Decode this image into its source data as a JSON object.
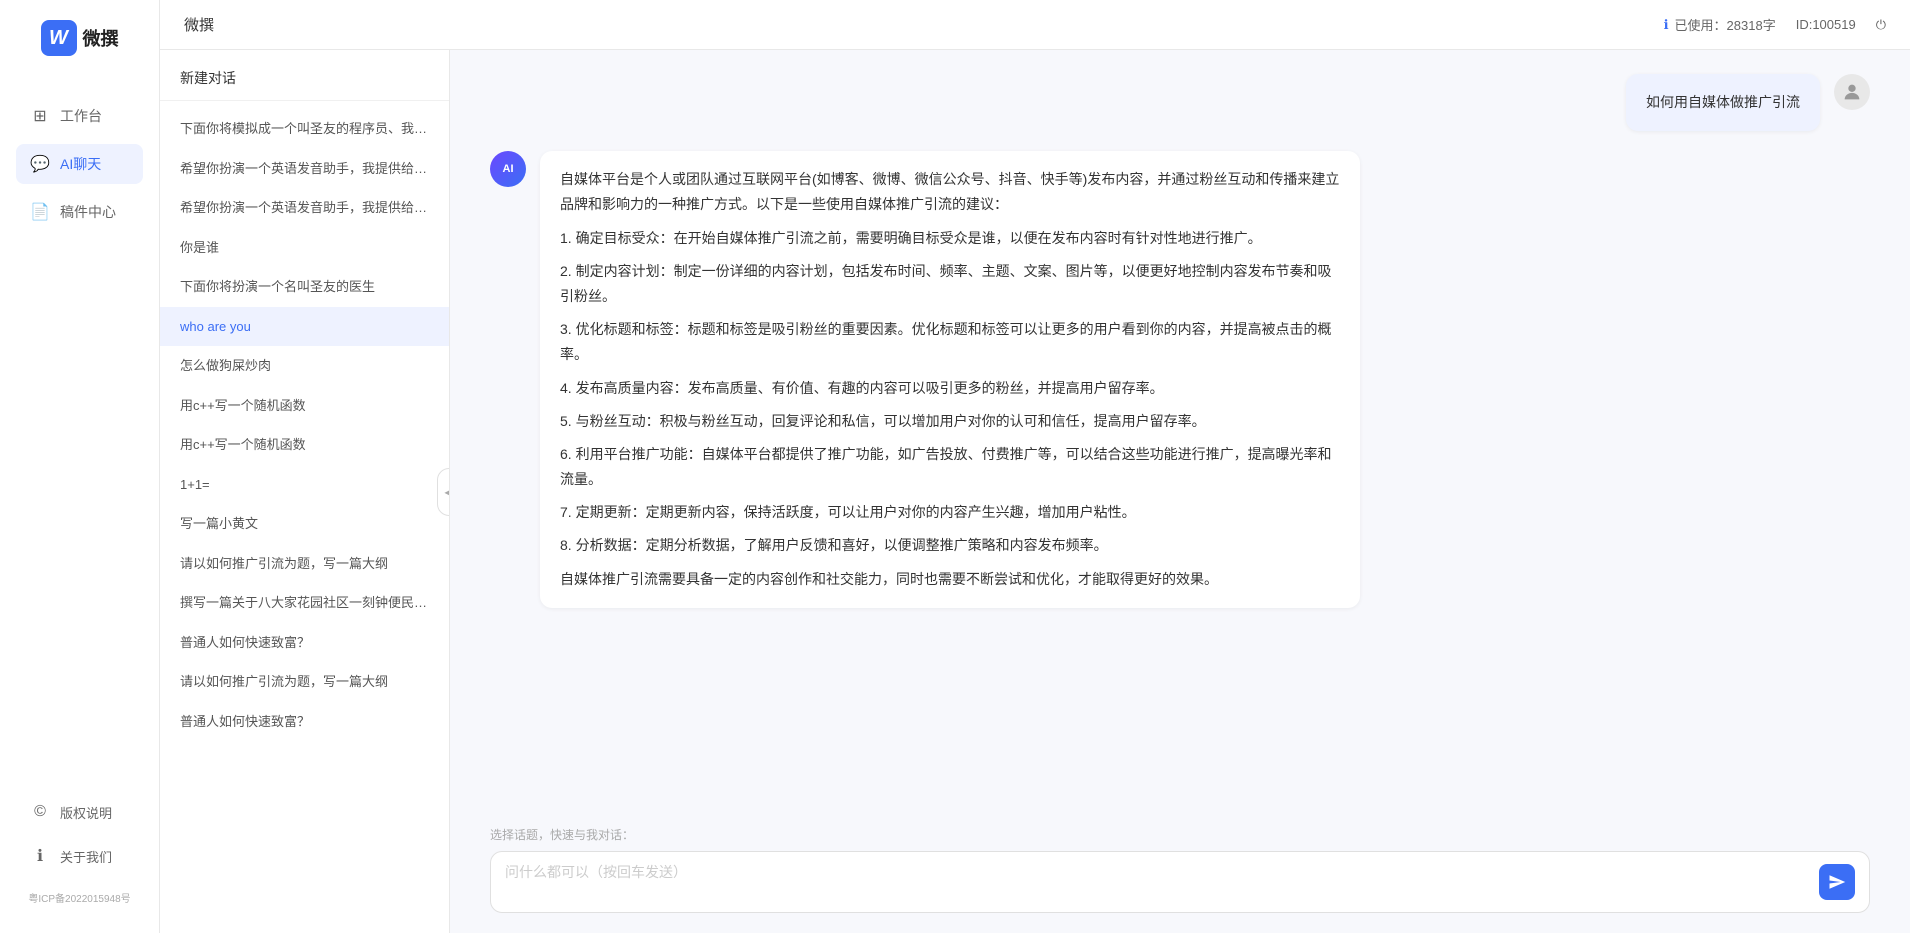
{
  "app": {
    "title": "微撰",
    "logo_letter": "W",
    "icp": "粤ICP备2022015948号"
  },
  "top_bar": {
    "title": "微撰",
    "usage_icon": "ℹ",
    "usage_label": "已使用：28318字",
    "id_label": "ID:100519",
    "logout_icon": "⏻"
  },
  "nav": {
    "items": [
      {
        "id": "workspace",
        "label": "工作台",
        "icon": "⊞"
      },
      {
        "id": "ai-chat",
        "label": "AI聊天",
        "icon": "💬"
      },
      {
        "id": "drafts",
        "label": "稿件中心",
        "icon": "📄"
      }
    ],
    "active": "ai-chat",
    "footer": [
      {
        "id": "copyright",
        "label": "版权说明",
        "icon": "©"
      },
      {
        "id": "about",
        "label": "关于我们",
        "icon": "ℹ"
      }
    ]
  },
  "history": {
    "new_chat_label": "新建对话",
    "items": [
      {
        "id": "h1",
        "text": "下面你将模拟成一个叫圣友的程序员、我说...",
        "active": false
      },
      {
        "id": "h2",
        "text": "希望你扮演一个英语发音助手，我提供给你...",
        "active": false
      },
      {
        "id": "h3",
        "text": "希望你扮演一个英语发音助手，我提供给你...",
        "active": false
      },
      {
        "id": "h4",
        "text": "你是谁",
        "active": false
      },
      {
        "id": "h5",
        "text": "下面你将扮演一个名叫圣友的医生",
        "active": false
      },
      {
        "id": "h6",
        "text": "who are you",
        "active": true
      },
      {
        "id": "h7",
        "text": "怎么做狗屎炒肉",
        "active": false
      },
      {
        "id": "h8",
        "text": "用c++写一个随机函数",
        "active": false
      },
      {
        "id": "h9",
        "text": "用c++写一个随机函数",
        "active": false
      },
      {
        "id": "h10",
        "text": "1+1=",
        "active": false
      },
      {
        "id": "h11",
        "text": "写一篇小黄文",
        "active": false
      },
      {
        "id": "h12",
        "text": "请以如何推广引流为题，写一篇大纲",
        "active": false
      },
      {
        "id": "h13",
        "text": "撰写一篇关于八大家花园社区一刻钟便民生...",
        "active": false
      },
      {
        "id": "h14",
        "text": "普通人如何快速致富？",
        "active": false
      },
      {
        "id": "h15",
        "text": "请以如何推广引流为题，写一篇大纲",
        "active": false
      },
      {
        "id": "h16",
        "text": "普通人如何快速致富？",
        "active": false
      }
    ]
  },
  "chat": {
    "messages": [
      {
        "id": "m1",
        "role": "user",
        "text": "如何用自媒体做推广引流",
        "avatar_type": "user"
      },
      {
        "id": "m2",
        "role": "ai",
        "text": "自媒体平台是个人或团队通过互联网平台(如博客、微博、微信公众号、抖音、快手等)发布内容，并通过粉丝互动和传播来建立品牌和影响力的一种推广方式。以下是一些使用自媒体推广引流的建议：\n\n1. 确定目标受众：在开始自媒体推广引流之前，需要明确目标受众是谁，以便在发布内容时有针对性地进行推广。\n\n2. 制定内容计划：制定一份详细的内容计划，包括发布时间、频率、主题、文案、图片等，以便更好地控制内容发布节奏和吸引粉丝。\n\n3. 优化标题和标签：标题和标签是吸引粉丝的重要因素。优化标题和标签可以让更多的用户看到你的内容，并提高被点击的概率。\n\n4. 发布高质量内容：发布高质量、有价值、有趣的内容可以吸引更多的粉丝，并提高用户留存率。\n\n5. 与粉丝互动：积极与粉丝互动，回复评论和私信，可以增加用户对你的认可和信任，提高用户留存率。\n\n6. 利用平台推广功能：自媒体平台都提供了推广功能，如广告投放、付费推广等，可以结合这些功能进行推广，提高曝光率和流量。\n\n7. 定期更新：定期更新内容，保持活跃度，可以让用户对你的内容产生兴趣，增加用户粘性。\n\n8. 分析数据：定期分析数据，了解用户反馈和喜好，以便调整推广策略和内容发布频率。\n\n自媒体推广引流需要具备一定的内容创作和社交能力，同时也需要不断尝试和优化，才能取得更好的效果。",
        "avatar_type": "ai"
      }
    ],
    "input_placeholder": "问什么都可以（按回车发送）",
    "quick_topics_label": "选择话题，快速与我对话："
  }
}
